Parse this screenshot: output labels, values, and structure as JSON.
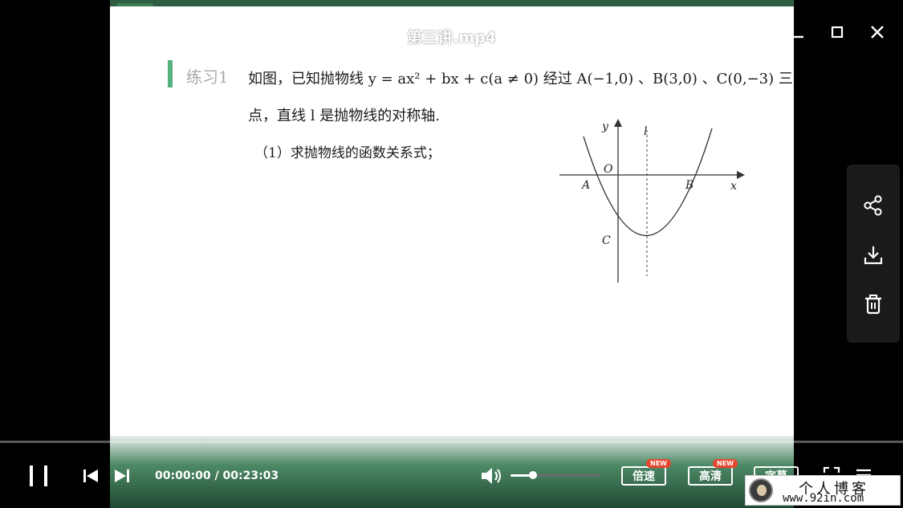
{
  "window": {
    "title": "第三讲.mp4"
  },
  "slide": {
    "exercise_label": "练习1",
    "line1": "如图，已知抛物线 y = ax² + bx + c(a ≠ 0) 经过 A(−1,0) 、B(3,0) 、C(0,−3) 三",
    "line2": "点，直线 l 是抛物线的对称轴.",
    "line3": "（1）求抛物线的函数关系式；",
    "graph": {
      "axis_x_label": "x",
      "axis_y_label": "y",
      "origin_label": "O",
      "axis_line_label": "l",
      "point_a": "A",
      "point_b": "B",
      "point_c": "C"
    }
  },
  "controls": {
    "time": "00:00:00 / 00:23:03",
    "volume_level": 0.25,
    "speed_label": "倍速",
    "quality_label": "高清",
    "subtitle_label": "字幕",
    "new_badge": "NEW"
  },
  "watermark": {
    "title": "个人博客",
    "url": "www.92in.com"
  },
  "icons": {
    "minimize": "minimize-icon",
    "maximize": "maximize-icon",
    "close": "close-icon",
    "share": "share-icon",
    "download": "download-icon",
    "delete": "trash-icon",
    "play_pause": "pause-icon",
    "prev": "skip-previous-icon",
    "next": "skip-next-icon",
    "volume": "volume-icon",
    "fullscreen": "fullscreen-icon",
    "more": "more-icon"
  },
  "colors": {
    "accent_green": "#55b07d",
    "badge_red": "#e8472f"
  }
}
